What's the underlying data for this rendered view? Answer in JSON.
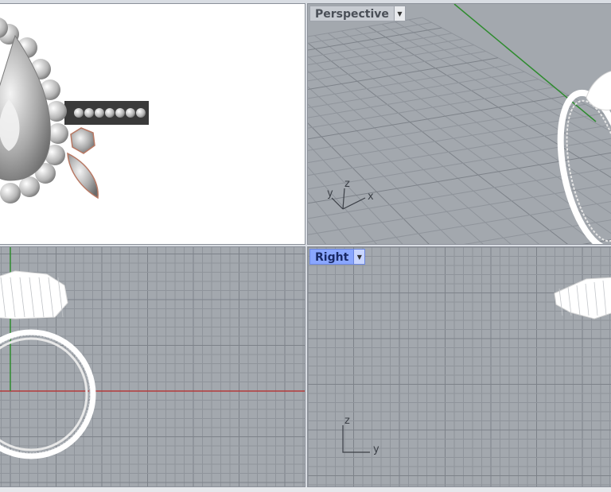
{
  "viewports": {
    "top_left": {
      "name": ""
    },
    "top_right": {
      "name": "Perspective",
      "active": false,
      "axes": {
        "x": "x",
        "y": "y",
        "z": "z"
      }
    },
    "bottom_left": {
      "name": ""
    },
    "bottom_right": {
      "name": "Right",
      "active": true,
      "axes": {
        "y": "y",
        "z": "z"
      }
    }
  },
  "icons": {
    "viewport_menu": "dropdown-arrow-icon"
  },
  "colors": {
    "grid_bg": "#a3a8ae",
    "grid_line": "#8f949b",
    "grid_major": "#7d8289",
    "axis_x": "#b43a3a",
    "axis_y": "#2e8b2e",
    "active_tab": "#8aa7ff"
  }
}
